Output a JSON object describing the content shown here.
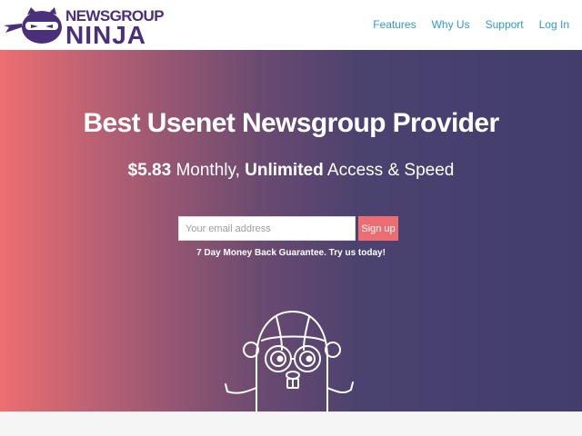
{
  "logo": {
    "text_top": "NEWSGROUP",
    "text_bottom": "NINJA",
    "mask_icon": "ninja-mask-icon",
    "brand_color": "#4a2f7a"
  },
  "nav": {
    "features": "Features",
    "why_us": "Why Us",
    "support": "Support",
    "login": "Log In",
    "link_color": "#2e9bc4"
  },
  "hero": {
    "title": "Best Usenet Newsgroup Provider",
    "price": "$5.83",
    "monthly": " Monthly, ",
    "unlimited": "Unlimited",
    "access_speed": " Access & Speed",
    "email_placeholder": "Your email address",
    "signup_label": "Sign up",
    "guarantee": "7 Day Money Back Guarantee. Try us today!",
    "mascot_icon": "gopher-mascot-icon",
    "gradient_start": "#ec6e72",
    "gradient_end": "#423d6c",
    "button_color": "#ec6e72"
  }
}
